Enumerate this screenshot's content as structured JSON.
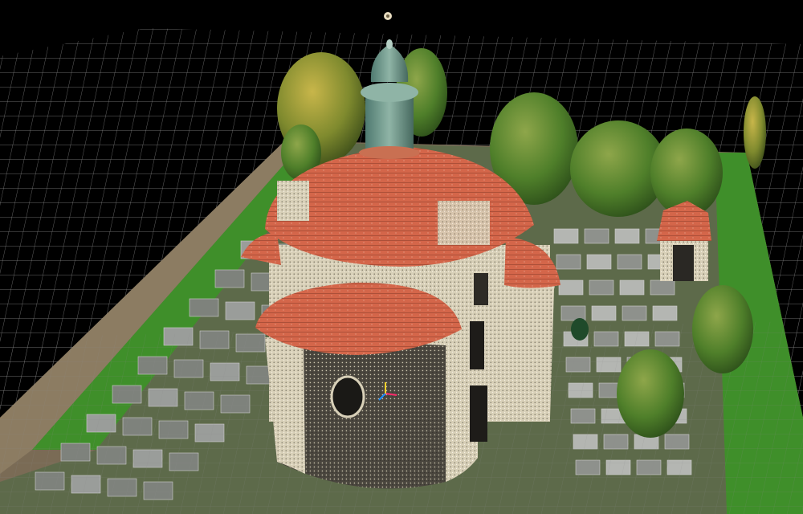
{
  "viewer": {
    "background_color": "#000000",
    "grid_color": "#8a8a8a",
    "grid_visible": true
  },
  "scene": {
    "subject": "chapel-point-cloud",
    "roof_color": "#d4664a",
    "wall_color": "#d8d0b8",
    "cupola_color": "#6f9a8e",
    "grass_color": "#3f8f2a",
    "tree_color": "#4f7f2a"
  },
  "gizmo": {
    "x_axis_color": "#ff2a6a",
    "y_axis_color": "#1a8cff",
    "z_axis_color": "#ffd12a"
  }
}
